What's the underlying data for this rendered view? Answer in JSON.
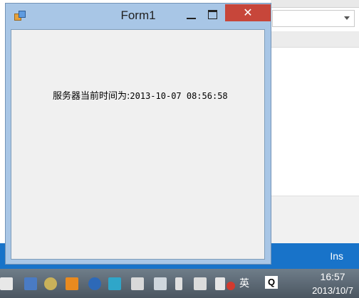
{
  "window": {
    "title": "Form1",
    "close_glyph": "✕",
    "label_prefix": "服务器当前时间为:",
    "label_value": "2013-10-07 08:56:58"
  },
  "statusbar": {
    "mode": "Ins"
  },
  "taskbar": {
    "ime": "英",
    "ime_q": "Q",
    "clock_time": "16:57",
    "clock_date": "2013/10/7",
    "icons": [
      "keyboard-icon",
      "pen-icon",
      "photo-icon",
      "shield-icon",
      "bluetooth-icon",
      "network-app-icon",
      "app-icon",
      "display-icon",
      "flag-icon",
      "battery-icon",
      "signal-icon",
      "volume-icon",
      "blocked-icon"
    ]
  },
  "colors": {
    "statusbar": "#1873c9",
    "close_button": "#c7463a",
    "window_frame": "#a8c6e6"
  }
}
